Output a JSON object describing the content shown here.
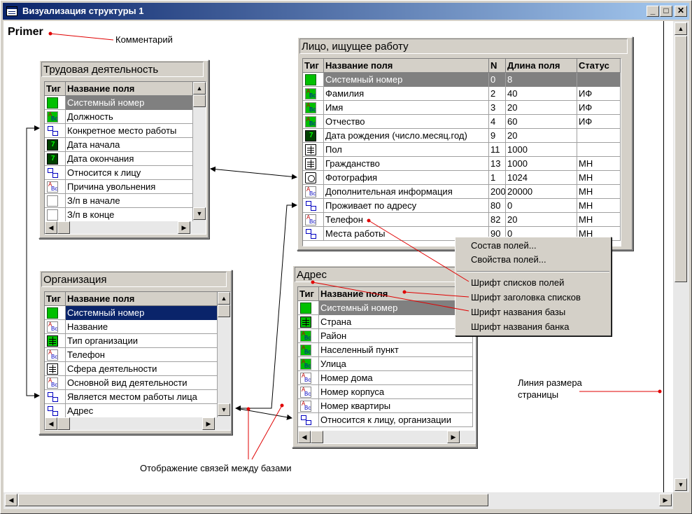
{
  "window": {
    "title": "Визуализация структуры 1"
  },
  "comment": "Primer",
  "annotations": {
    "comment": "Комментарий",
    "page_size_line": "Линия размера\nстраницы",
    "links": "Отображение связей между базами"
  },
  "context_menu": {
    "items": [
      "Состав полей...",
      "Свойства полей...",
      "Шрифт списков полей",
      "Шрифт заголовка списков",
      "Шрифт названия базы",
      "Шрифт названия банка"
    ]
  },
  "tables": {
    "trud": {
      "title": "Трудовая деятельность",
      "headers": [
        "Тиг",
        "Название поля"
      ],
      "rows": [
        {
          "icon": "num-green",
          "name": "Системный номер",
          "sel": "gray"
        },
        {
          "icon": "abc-green",
          "name": "Должность"
        },
        {
          "icon": "link",
          "name": "Конкретное место работы"
        },
        {
          "icon": "date",
          "name": "Дата начала"
        },
        {
          "icon": "date",
          "name": "Дата окончания"
        },
        {
          "icon": "link",
          "name": "Относится к лицу"
        },
        {
          "icon": "abc",
          "name": "Причина увольнения"
        },
        {
          "icon": "num",
          "name": "З/п в начале"
        },
        {
          "icon": "num",
          "name": "З/п в конце"
        }
      ]
    },
    "lico": {
      "title": "Лицо, ищущее работу",
      "headers": [
        "Тиг",
        "Название поля",
        "N",
        "Длина поля",
        "Статус"
      ],
      "rows": [
        {
          "icon": "num-green",
          "name": "Системный номер",
          "n": "0",
          "len": "8",
          "status": "",
          "sel": "gray"
        },
        {
          "icon": "abc-green",
          "name": "Фамилия",
          "n": "2",
          "len": "40",
          "status": "ИФ"
        },
        {
          "icon": "abc-green",
          "name": "Имя",
          "n": "3",
          "len": "20",
          "status": "ИФ"
        },
        {
          "icon": "abc-green",
          "name": "Отчество",
          "n": "4",
          "len": "60",
          "status": "ИФ"
        },
        {
          "icon": "date",
          "name": "Дата рождения (число.месяц.год)",
          "n": "9",
          "len": "20",
          "status": ""
        },
        {
          "icon": "book",
          "name": "Пол",
          "n": "11",
          "len": "1000",
          "status": ""
        },
        {
          "icon": "book",
          "name": "Гражданство",
          "n": "13",
          "len": "1000",
          "status": "МН"
        },
        {
          "icon": "photo",
          "name": "Фотография",
          "n": "1",
          "len": "1024",
          "status": "МН"
        },
        {
          "icon": "abc",
          "name": "Дополнительная информация",
          "n": "200",
          "len": "20000",
          "status": "МН"
        },
        {
          "icon": "link",
          "name": "Проживает по адресу",
          "n": "80",
          "len": "0",
          "status": "МН"
        },
        {
          "icon": "abc",
          "name": "Телефон",
          "n": "82",
          "len": "20",
          "status": "МН"
        },
        {
          "icon": "link",
          "name": "Места работы",
          "n": "90",
          "len": "0",
          "status": "МН"
        }
      ]
    },
    "org": {
      "title": "Организация",
      "headers": [
        "Тиг",
        "Название поля"
      ],
      "rows": [
        {
          "icon": "num-green",
          "name": "Системный номер",
          "sel": "blue"
        },
        {
          "icon": "abc",
          "name": "Название"
        },
        {
          "icon": "book-green",
          "name": "Тип организации"
        },
        {
          "icon": "abc",
          "name": "Телефон"
        },
        {
          "icon": "book",
          "name": "Сфера деятельности"
        },
        {
          "icon": "abc",
          "name": "Основной вид деятельности"
        },
        {
          "icon": "link",
          "name": "Является местом работы лица"
        },
        {
          "icon": "link",
          "name": "Адрес"
        }
      ]
    },
    "adres": {
      "title": "Адрес",
      "headers": [
        "Тиг",
        "Название поля"
      ],
      "rows": [
        {
          "icon": "num-green",
          "name": "Системный номер",
          "sel": "gray"
        },
        {
          "icon": "book-green",
          "name": "Страна"
        },
        {
          "icon": "abc-green",
          "name": "Район"
        },
        {
          "icon": "abc-green",
          "name": "Населенный пункт"
        },
        {
          "icon": "abc-green",
          "name": "Улица"
        },
        {
          "icon": "abc",
          "name": "Номер дома"
        },
        {
          "icon": "abc",
          "name": "Номер корпуса"
        },
        {
          "icon": "abc",
          "name": "Номер квартиры"
        },
        {
          "icon": "link",
          "name": "Относится к лицу, организации"
        }
      ]
    }
  },
  "icons": {
    "minimize": "minimize-icon",
    "maximize": "maximize-icon",
    "close": "close-icon",
    "arrow_up": "▲",
    "arrow_down": "▼",
    "arrow_left": "◀",
    "arrow_right": "▶"
  },
  "colors": {
    "titlebar": "#0a246a",
    "selection_gray": "#808080",
    "selection_blue": "#0a246a",
    "pointer_line": "#e00000"
  }
}
